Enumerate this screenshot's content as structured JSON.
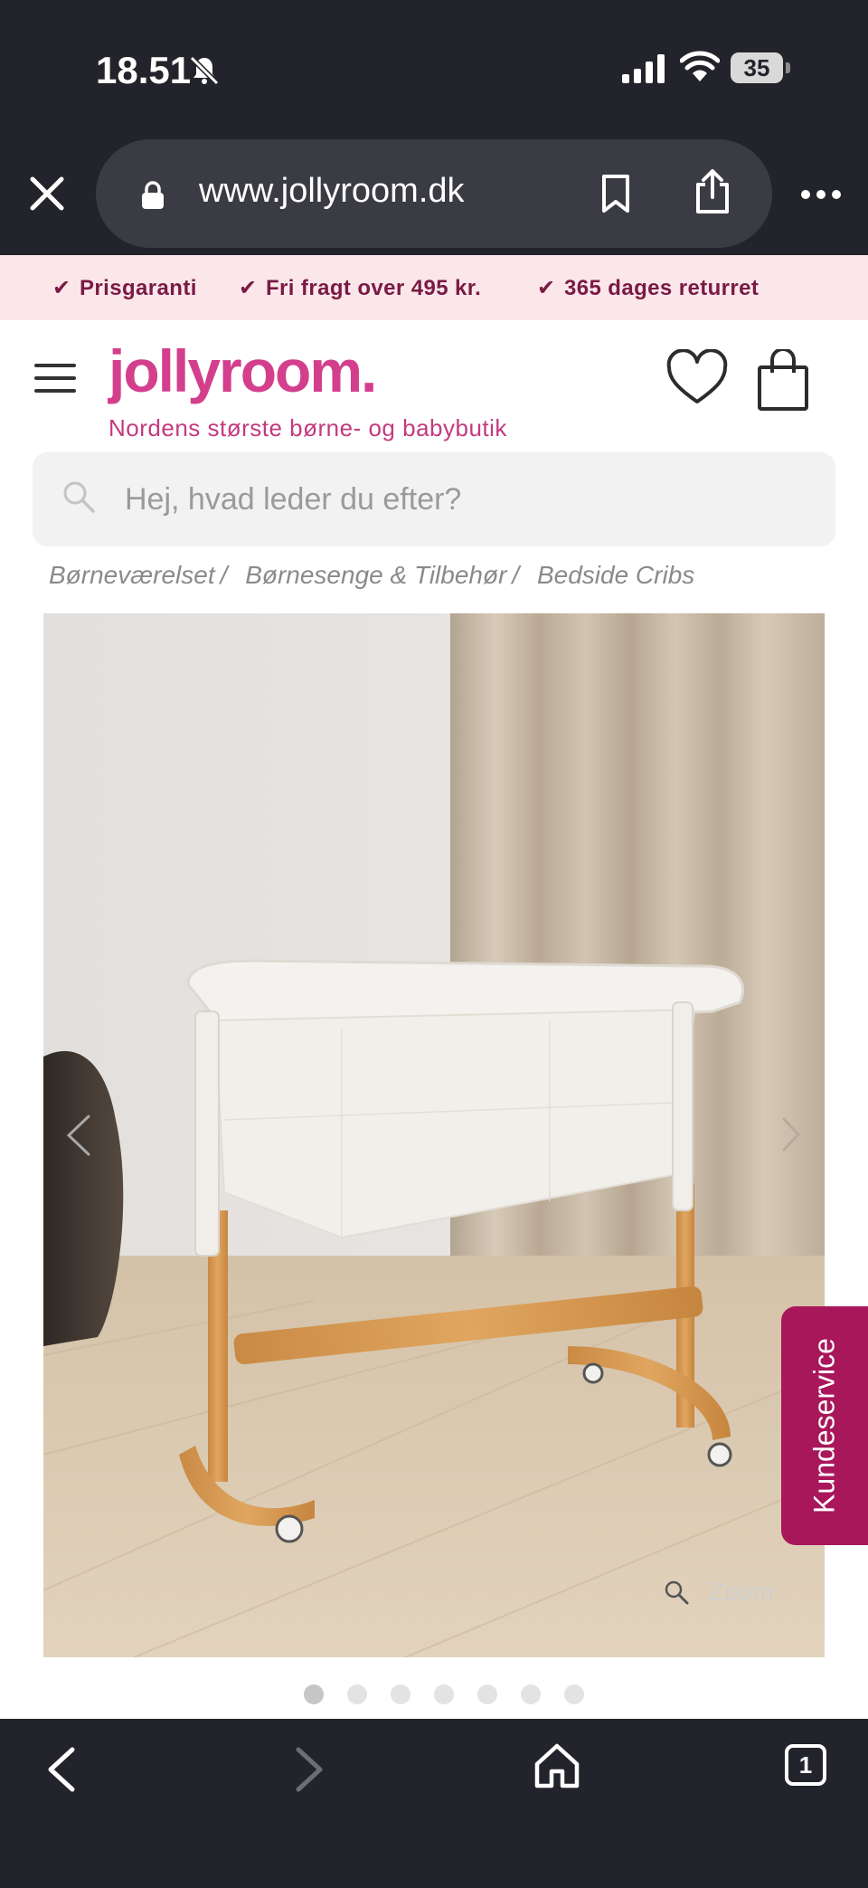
{
  "status_bar": {
    "time": "18.51",
    "battery": "35"
  },
  "browser": {
    "url": "www.jollyroom.dk",
    "tab_count": "1"
  },
  "promo": [
    "Prisgaranti",
    "Fri fragt over 495 kr.",
    "365 dages returret"
  ],
  "header": {
    "logo": "jollyroom.",
    "tagline": "Nordens største børne- og babybutik"
  },
  "search": {
    "placeholder": "Hej, hvad leder du efter?",
    "value": ""
  },
  "breadcrumb": [
    "Børneværelset",
    "Børnesenge & Tilbehør",
    "Bedside Cribs"
  ],
  "product_gallery": {
    "zoom_label": "Zoom",
    "image_count": 7,
    "active_index": 0
  },
  "customer_service": {
    "label": "Kundeservice"
  },
  "colors": {
    "brand_pink": "#d43f8d",
    "promo_bg": "#fbe7ea",
    "kundeservice_bg": "#a8175a",
    "chrome_dark": "#23242b"
  }
}
